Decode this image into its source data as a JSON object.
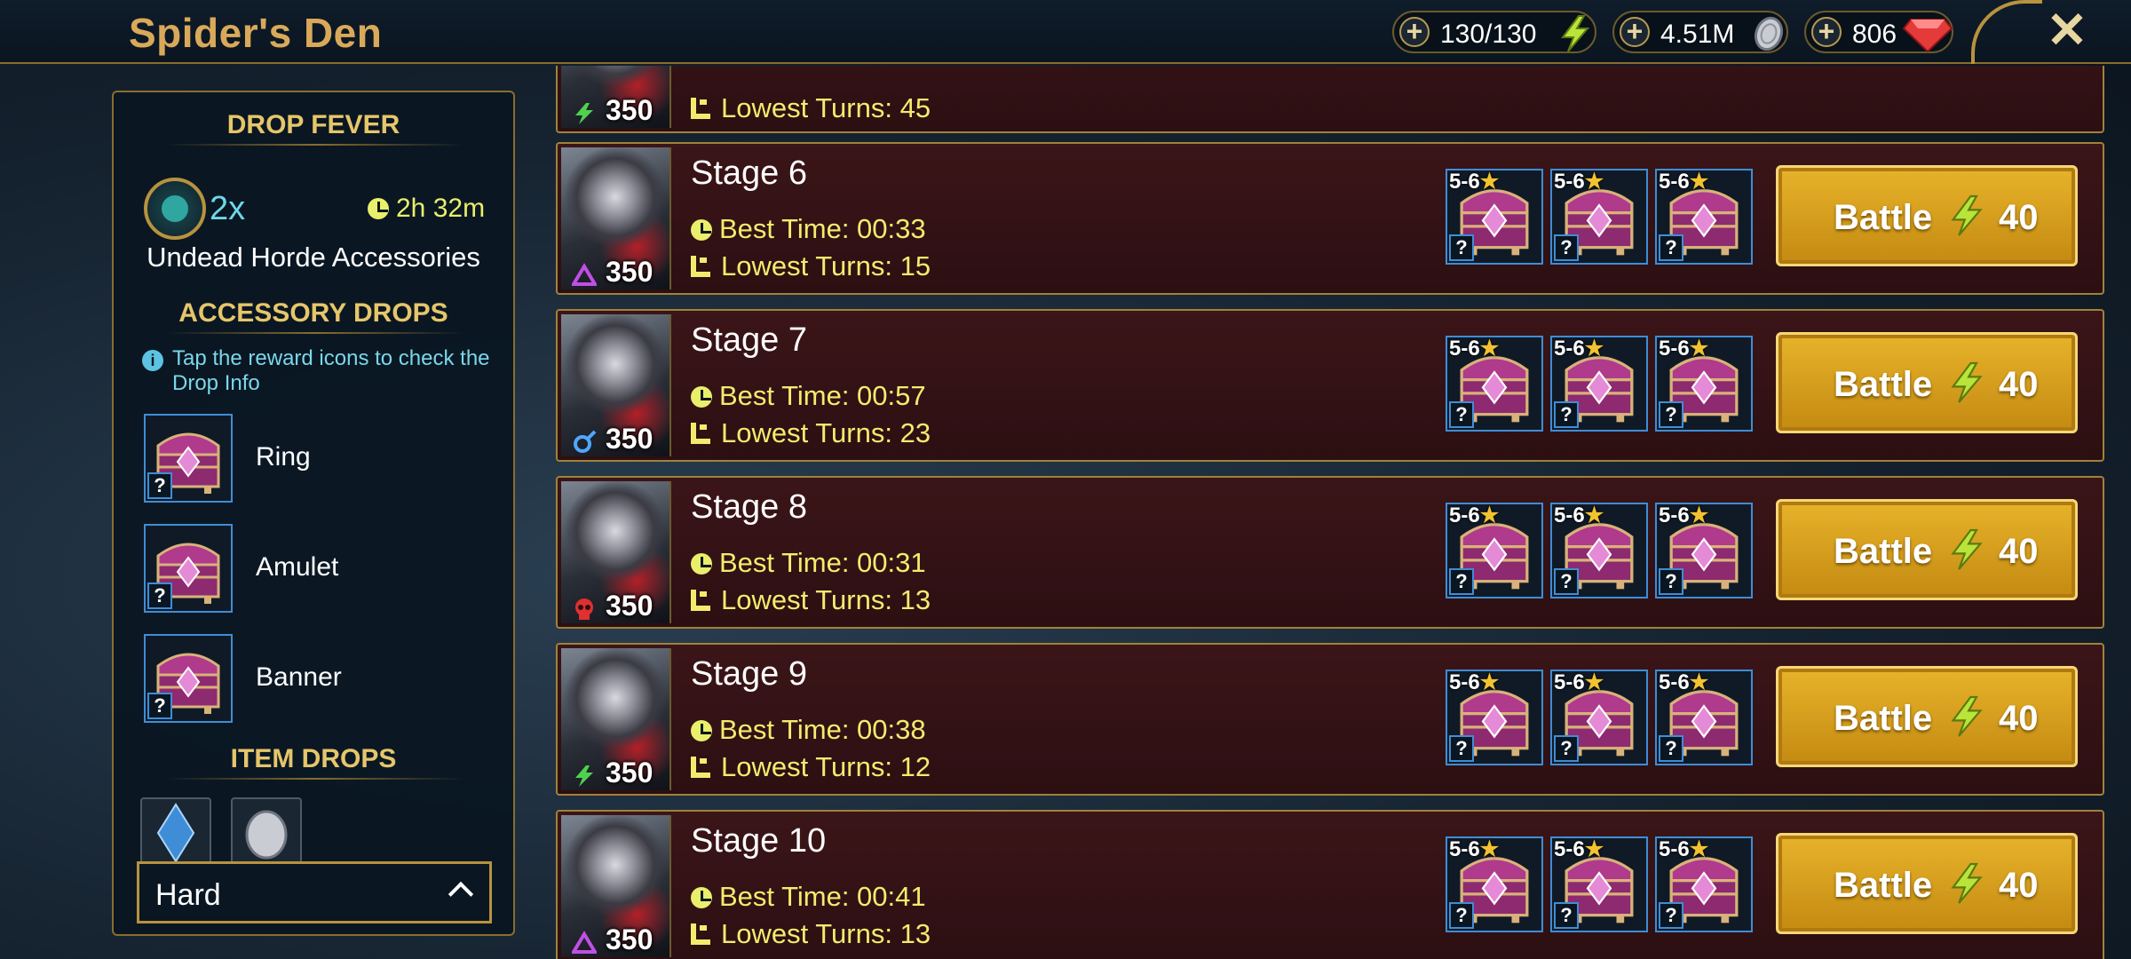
{
  "header": {
    "title": "Spider's Den",
    "energy": "130/130",
    "silver": "4.51M",
    "gems": "806",
    "energy_icon": "lightning-bolt-icon",
    "silver_icon": "silver-coin-icon",
    "gem_icon": "ruby-gem-icon"
  },
  "panel": {
    "drop_fever_title": "DROP FEVER",
    "multiplier": "2x",
    "timer": "2h 32m",
    "set_name": "Undead Horde Accessories",
    "accessory_title": "ACCESSORY DROPS",
    "info_text": "Tap the reward icons to check the Drop Info",
    "accessories": [
      {
        "label": "Ring",
        "qm": "?"
      },
      {
        "label": "Amulet",
        "qm": "?"
      },
      {
        "label": "Banner",
        "qm": "?"
      }
    ],
    "item_title": "ITEM DROPS",
    "difficulty": "Hard"
  },
  "stages": [
    {
      "title": "",
      "level": "350",
      "best": "",
      "turns": "Lowest Turns: 45",
      "affinity": "force"
    },
    {
      "title": "Stage 6",
      "level": "350",
      "best": "Best Time: 00:33",
      "turns": "Lowest Turns: 15",
      "affinity": "magic"
    },
    {
      "title": "Stage 7",
      "level": "350",
      "best": "Best Time: 00:57",
      "turns": "Lowest Turns: 23",
      "affinity": "spirit"
    },
    {
      "title": "Stage 8",
      "level": "350",
      "best": "Best Time: 00:31",
      "turns": "Lowest Turns: 13",
      "affinity": "void"
    },
    {
      "title": "Stage 9",
      "level": "350",
      "best": "Best Time: 00:38",
      "turns": "Lowest Turns: 12",
      "affinity": "force"
    },
    {
      "title": "Stage 10",
      "level": "350",
      "best": "Best Time: 00:41",
      "turns": "Lowest Turns: 13",
      "affinity": "magic"
    }
  ],
  "reward": {
    "stars_range": "5-6",
    "star": "★",
    "qm": "?"
  },
  "battle": {
    "label": "Battle",
    "cost": "40"
  },
  "colors": {
    "gold": "#d9a95a",
    "battle": "#e7b32a",
    "stat": "#f2ec6e",
    "chest_border": "#3f8dd6"
  }
}
